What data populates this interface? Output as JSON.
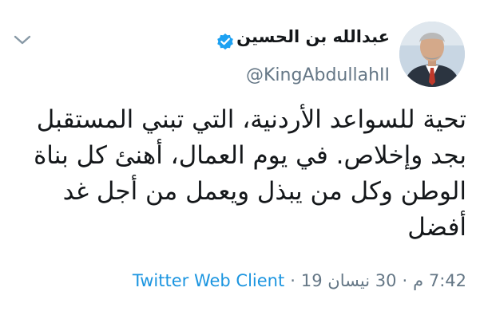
{
  "author": {
    "name": "عبدالله بن الحسين",
    "handle": "@KingAbdullahII",
    "verified": true,
    "avatar_icon": "profile-photo-icon"
  },
  "tweet": {
    "text_lines": [
      "تحية للسواعد الأردنية، التي تبني المستقبل",
      "بجد وإخلاص. في يوم العمال، أهنئ كل بناة",
      "الوطن وكل من يبذل ويعمل من أجل غد",
      "أفضل"
    ]
  },
  "meta": {
    "time": "7:42 م",
    "separator": "·",
    "date": "30 نيسان 19",
    "source": "Twitter Web Client"
  },
  "icons": {
    "verified": "verified-badge-icon",
    "menu": "chevron-down-icon"
  },
  "colors": {
    "text": "#14171a",
    "muted": "#657786",
    "link": "#1b95e0",
    "verified": "#1da1f2"
  }
}
